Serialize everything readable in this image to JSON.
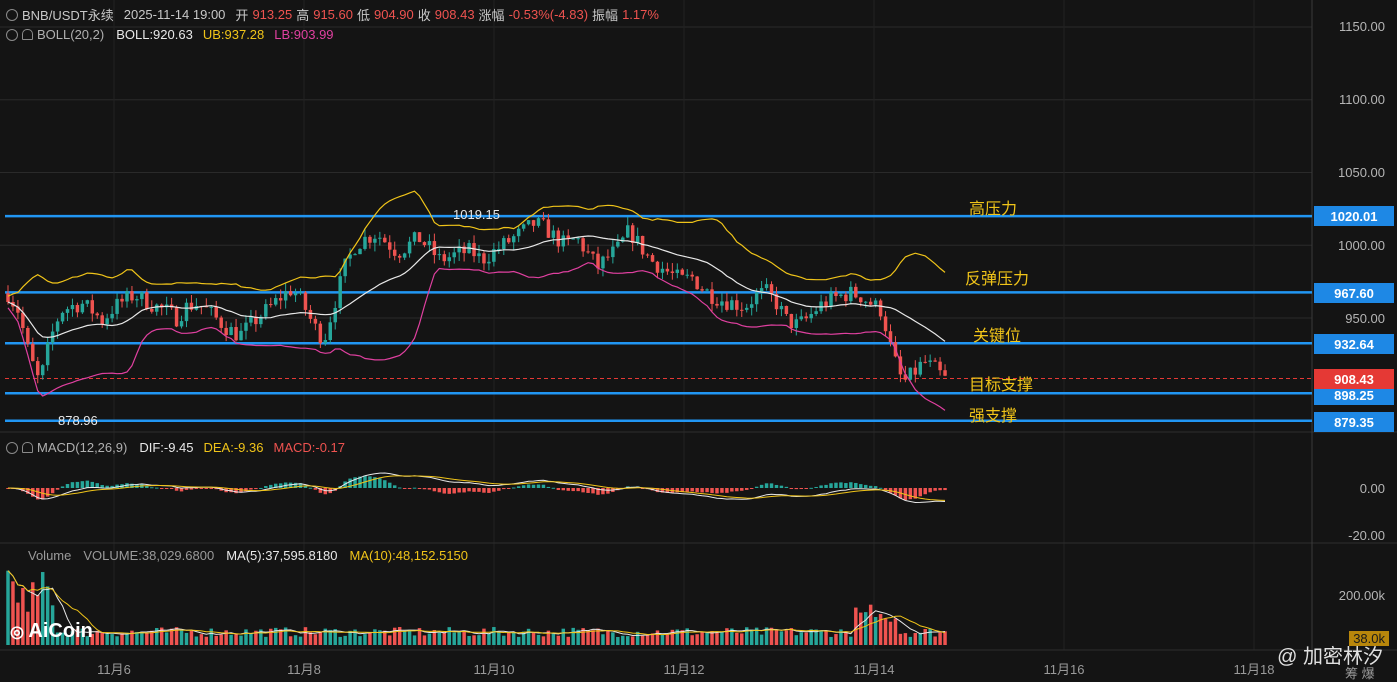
{
  "header": {
    "symbol": "BNB/USDT永续",
    "datetime": "2025-11-14 19:00",
    "open_label": "开",
    "open": "913.25",
    "high_label": "高",
    "high": "915.60",
    "low_label": "低",
    "low": "904.90",
    "close_label": "收",
    "close": "908.43",
    "change_label": "涨幅",
    "change": "-0.53%(-4.83)",
    "amp_label": "振幅",
    "amp": "1.17%"
  },
  "boll": {
    "label": "BOLL(20,2)",
    "mid": "BOLL:920.63",
    "ub": "UB:937.28",
    "lb": "LB:903.99"
  },
  "macd": {
    "label": "MACD(12,26,9)",
    "dif": "DIF:-9.45",
    "dea": "DEA:-9.36",
    "macd": "MACD:-0.17"
  },
  "volume": {
    "label": "Volume",
    "vol": "VOLUME:38,029.6800",
    "ma5": "MA(5):37,595.8180",
    "ma10": "MA(10):48,152.5150"
  },
  "price_axis": [
    "1150.00",
    "1100.00",
    "1050.00",
    "1000.00",
    "950.00"
  ],
  "macd_axis": [
    "0.00",
    "-20.00"
  ],
  "vol_axis": [
    "200.00k",
    "38.0k"
  ],
  "dates": [
    "11月6",
    "11月8",
    "11月10",
    "11月12",
    "11月14",
    "11月16",
    "11月18"
  ],
  "annotations": {
    "high_mark": "1019.15",
    "low_mark": "878.96"
  },
  "levels": [
    {
      "price": "1020.01",
      "text": "高压力"
    },
    {
      "price": "967.60",
      "text": "反弹压力"
    },
    {
      "price": "932.64",
      "text": "关键位"
    },
    {
      "price": "898.25",
      "text": "目标支撑"
    },
    {
      "price": "879.35",
      "text": "强支撑"
    }
  ],
  "current_price": "908.43",
  "brand": "AiCoin",
  "watermark": "@ 加密林汐",
  "watermark2": "筹 爆",
  "colors": {
    "up": "#26a69a",
    "down": "#ef5350",
    "level": "#2196f3",
    "yellow": "#f0c419",
    "pink": "#e040a0",
    "current": "#e53935"
  },
  "chart_data": {
    "type": "candlestick",
    "interval": "1h",
    "price_ylim": [
      860,
      1160
    ],
    "x": [
      "11月6",
      "11月8",
      "11月10",
      "11月12",
      "11月14",
      "11月16",
      "11月18"
    ],
    "close_path": [
      967,
      955,
      925,
      905,
      935,
      955,
      958,
      960,
      955,
      948,
      957,
      962,
      966,
      962,
      958,
      955,
      950,
      958,
      960,
      955,
      948,
      942,
      938,
      945,
      952,
      958,
      965,
      970,
      960,
      945,
      935,
      960,
      985,
      1000,
      1005,
      1008,
      1002,
      995,
      1000,
      1005,
      998,
      990,
      992,
      995,
      996,
      990,
      995,
      1000,
      1005,
      1010,
      1015,
      1012,
      1005,
      1000,
      1005,
      995,
      985,
      992,
      998,
      1010,
      1000,
      990,
      985,
      980,
      976,
      978,
      970,
      965,
      962,
      960,
      958,
      965,
      968,
      960,
      948,
      945,
      950,
      958,
      962,
      965,
      967,
      965,
      960,
      955,
      925,
      905,
      912,
      920,
      915,
      908
    ],
    "levels": [
      1020.01,
      967.6,
      932.64,
      898.25,
      879.35
    ],
    "current": 908.43
  }
}
